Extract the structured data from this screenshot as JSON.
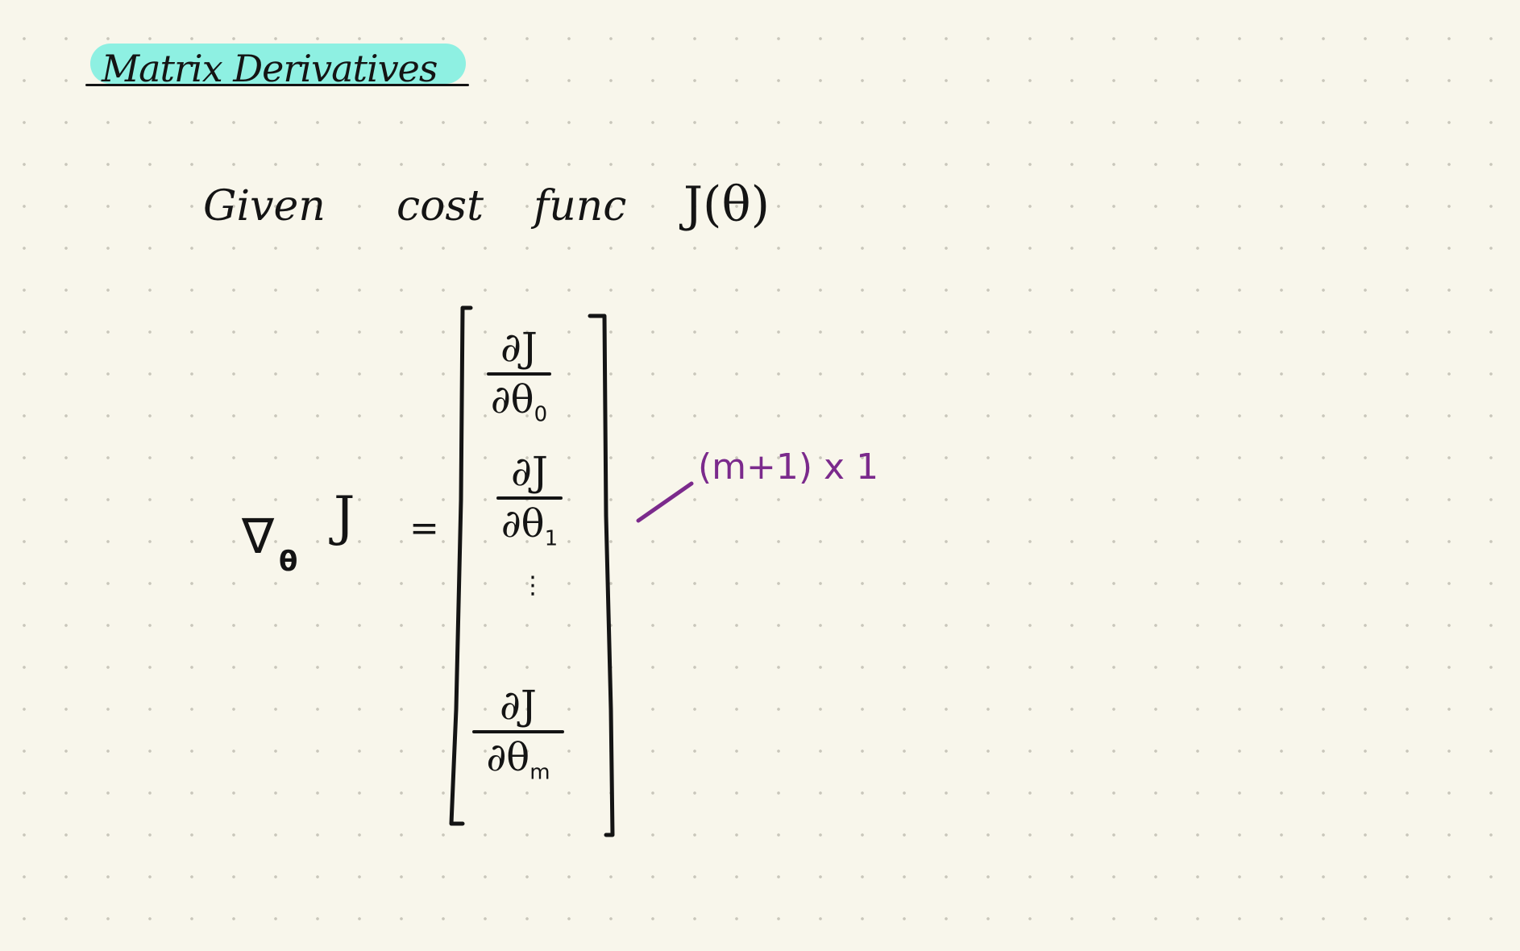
{
  "note": {
    "title": "Matrix Derivatives",
    "given_line": [
      "Given",
      "cost",
      "func",
      "J(θ)"
    ],
    "gradient": {
      "nabla": "∇",
      "subscript": "θ",
      "function": "J",
      "equals": "="
    },
    "vector_entries": [
      {
        "numerator": "∂J",
        "denominator": "∂θ",
        "subscript": "0"
      },
      {
        "numerator": "∂J",
        "denominator": "∂θ",
        "subscript": "1"
      },
      {
        "numerator": "∂J",
        "denominator": "∂θ",
        "subscript": "m"
      }
    ],
    "vdots": "⋮",
    "dimension_annotation": "(m+1) x 1",
    "colors": {
      "paper": "#f8f6eb",
      "ink": "#141414",
      "highlight": "#8ef0e2",
      "annotation": "#7b2a8c"
    }
  }
}
